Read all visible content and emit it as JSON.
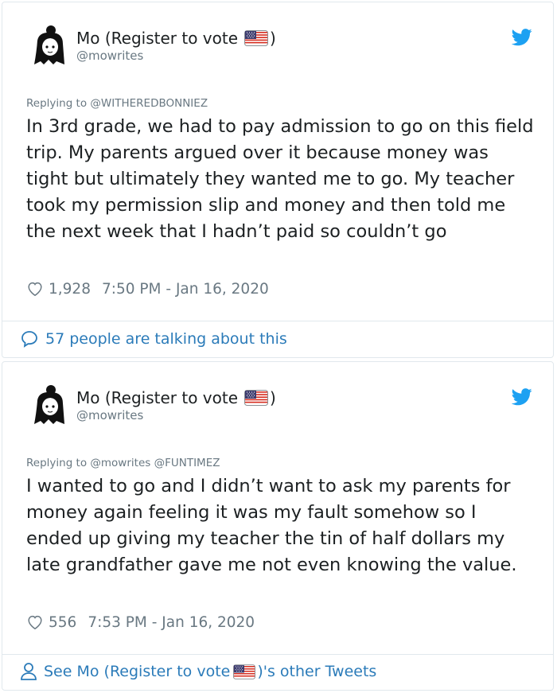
{
  "tweets": [
    {
      "author_name": "Mo (Register to vote",
      "author_name_end": ")",
      "handle": "@mowrites",
      "replying_to": "Replying to @WITHEREDBONNIEZ",
      "text": "In 3rd grade, we had to pay admission to go on this field trip. My parents argued over it because money was tight but ultimately they wanted me to go. My teacher took my permission slip and money and then told me the next week that I hadn’t paid so couldn’t go",
      "likes": "1,928",
      "timestamp": "7:50 PM - Jan 16, 2020",
      "footer": "57 people are talking about this",
      "icons": [
        "avatar",
        "us-flag-icon",
        "twitter-bird-icon",
        "heart-icon",
        "speech-bubble-icon"
      ]
    },
    {
      "author_name": "Mo (Register to vote",
      "author_name_end": ")",
      "handle": "@mowrites",
      "replying_to": "Replying to @mowrites @FUNTIMEZ",
      "text": "I wanted to go and I didn’t want to ask my parents for money again feeling it was my fault somehow so I ended up giving my teacher the tin of half dollars my late grandfather gave me not even knowing the value.",
      "likes": "556",
      "timestamp": "7:53 PM - Jan 16, 2020",
      "footer_pre": "See Mo (Register to vote",
      "footer_post": ")'s other Tweets",
      "icons": [
        "avatar",
        "us-flag-icon",
        "twitter-bird-icon",
        "heart-icon",
        "person-icon"
      ]
    }
  ],
  "colors": {
    "text": "#1c2022",
    "secondary": "#697882",
    "link": "#2b7bb9",
    "twitter_blue": "#1da1f2",
    "border": "#e1e8ed"
  }
}
